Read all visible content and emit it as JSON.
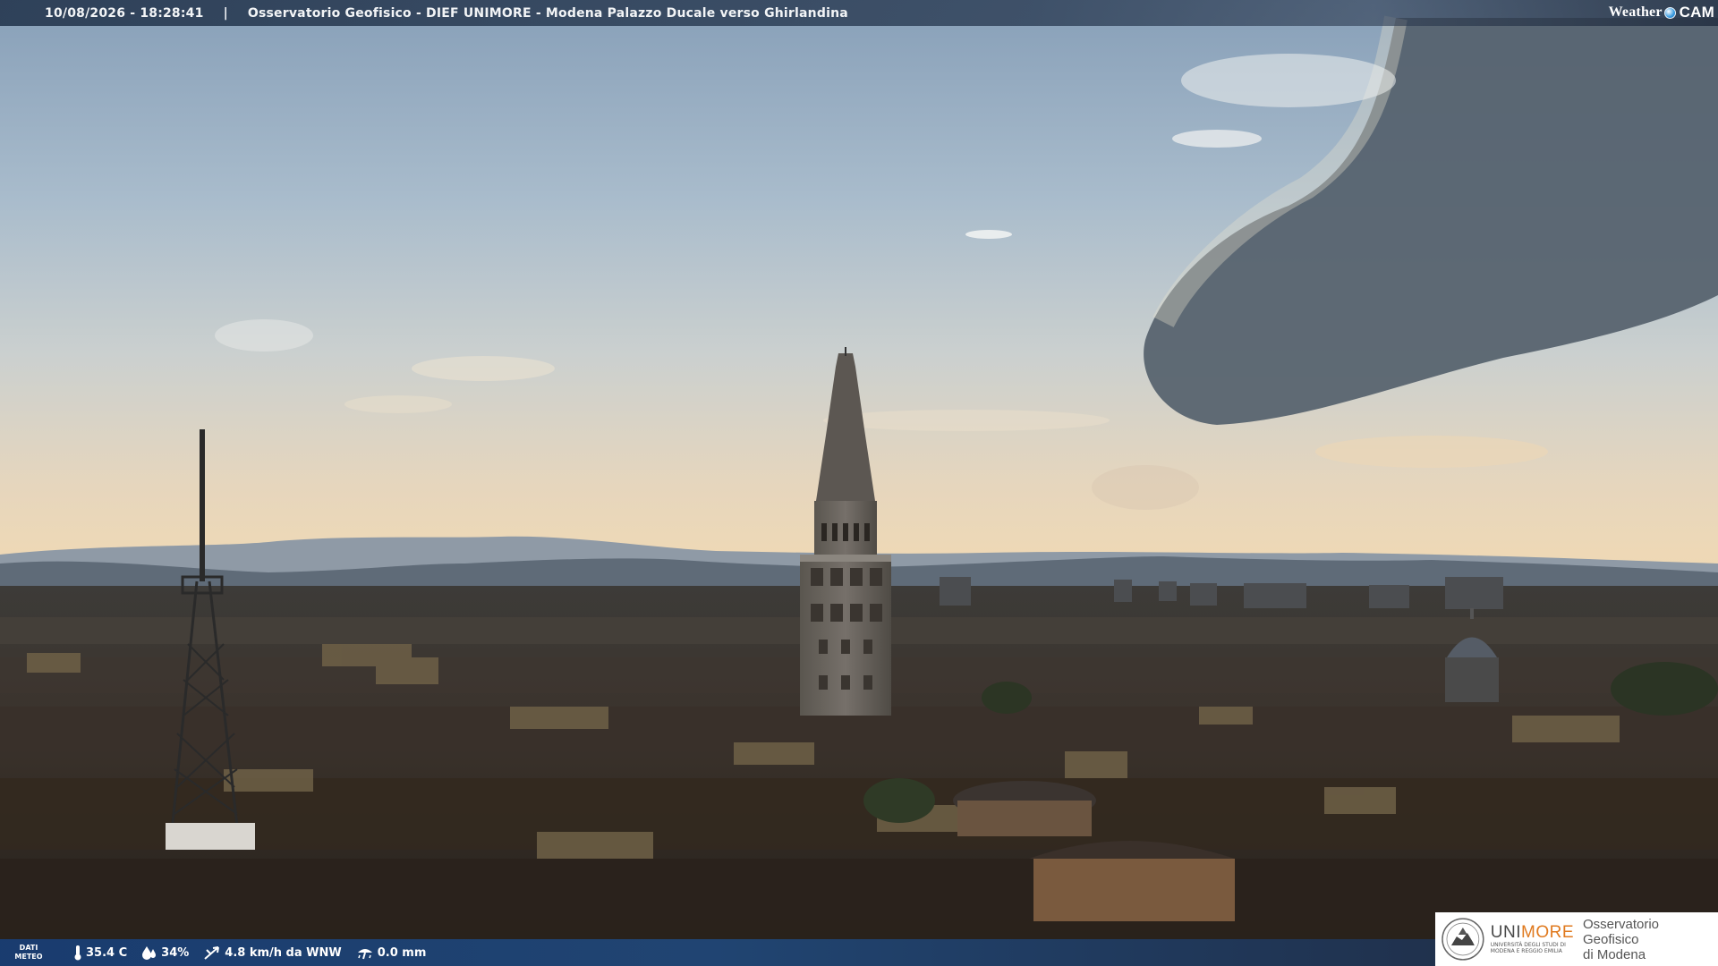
{
  "header": {
    "timestamp": "10/08/2026 - 18:28:41",
    "separator": "|",
    "title": "Osservatorio Geofisico - DIEF UNIMORE - Modena Palazzo Ducale verso Ghirlandina"
  },
  "brand": {
    "weather": "Weather",
    "cam": "CAM"
  },
  "weather_bar": {
    "label_line1": "DATI",
    "label_line2": "METEO",
    "temperature": "35.4 C",
    "humidity": "34%",
    "wind": "4.8 km/h da WNW",
    "rain": "0.0 mm"
  },
  "logo": {
    "uni": "UNI",
    "more": "MORE",
    "university_sub": "UNIVERSITÀ DEGLI STUDI DI MODENA E REGGIO EMILIA",
    "observatory_line1": "Osservatorio Geofisico",
    "observatory_line2": "di Modena"
  },
  "colors": {
    "sky_top": "#8ea8c0",
    "sky_horizon": "#e8d4b4",
    "storm_cloud": "#4e5a66",
    "city": "#2e2823",
    "accent_orange": "#e07a1f"
  }
}
